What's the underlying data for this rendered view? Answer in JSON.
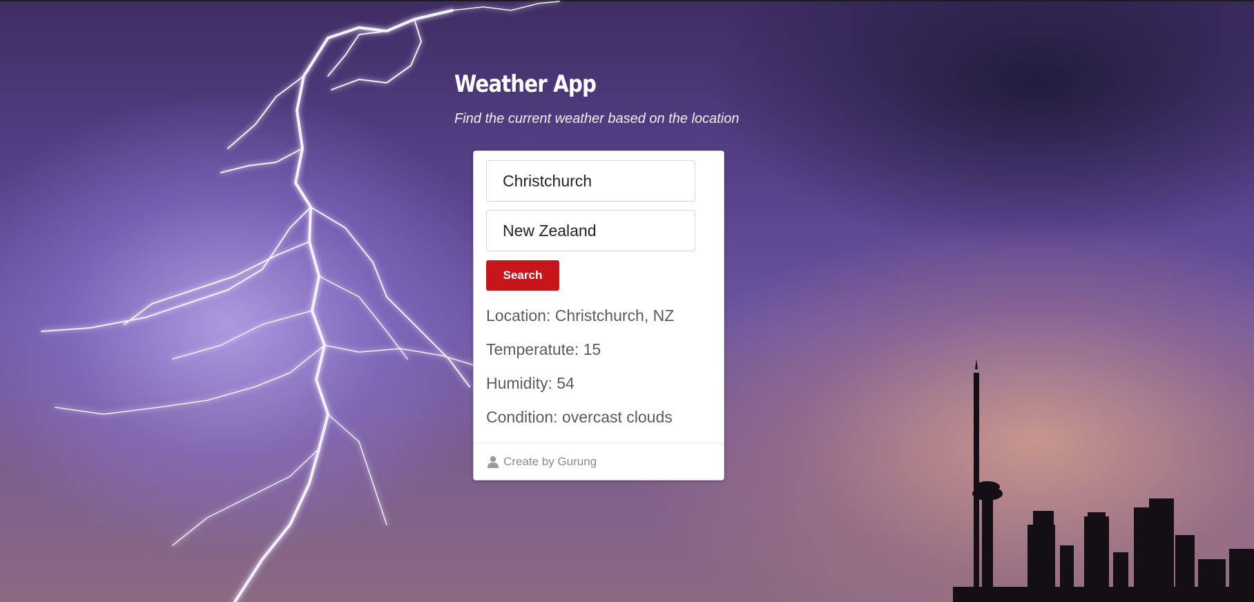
{
  "app": {
    "title": "Weather App",
    "subtitle": "Find the current weather based on the location"
  },
  "form": {
    "city_value": "Christchurch",
    "country_value": "New Zealand",
    "search_label": "Search"
  },
  "results": {
    "location": "Location: Christchurch, NZ",
    "temperature": "Temperatute: 15",
    "humidity": "Humidity: 54",
    "condition": "Condition: overcast clouds"
  },
  "footer": {
    "icon": "user-icon",
    "credit": "Create by Gurung"
  },
  "colors": {
    "accent": "#c8141b",
    "card_bg": "#ffffff",
    "info_text": "#5a5a5a"
  }
}
